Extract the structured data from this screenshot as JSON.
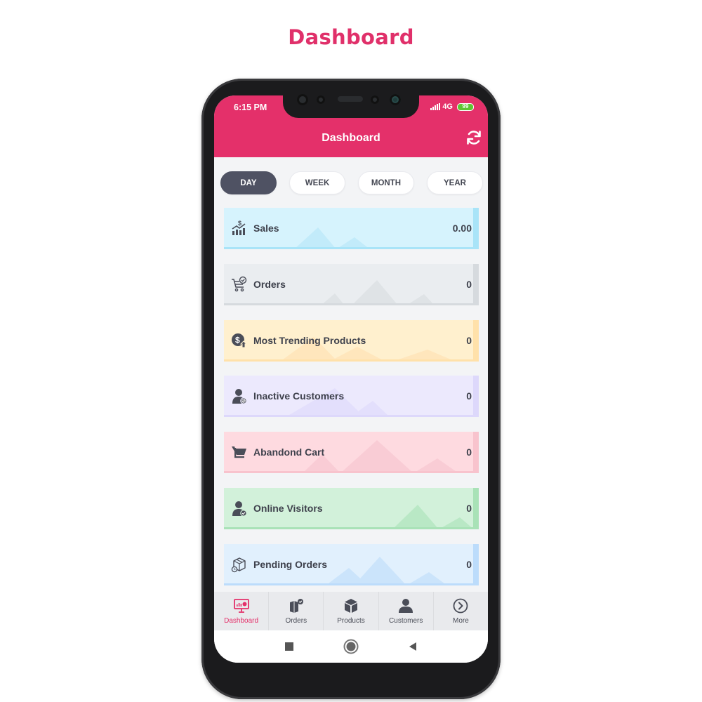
{
  "page": {
    "title": "Dashboard"
  },
  "status_bar": {
    "time": "6:15 PM",
    "network": "4G",
    "battery": "99"
  },
  "header": {
    "title": "Dashboard",
    "refresh_icon": "refresh-icon"
  },
  "period_tabs": [
    {
      "label": "DAY",
      "active": true
    },
    {
      "label": "WEEK",
      "active": false
    },
    {
      "label": "MONTH",
      "active": false
    },
    {
      "label": "YEAR",
      "active": false
    }
  ],
  "cards": [
    {
      "label": "Sales",
      "value": "0.00",
      "icon": "sales-chart-icon",
      "bg": "#d6f3fd",
      "accent": "#a9e4f8",
      "mountain": "#c2ebfa"
    },
    {
      "label": "Orders",
      "value": "0",
      "icon": "cart-check-icon",
      "bg": "#eaedf0",
      "accent": "#d6dade",
      "mountain": "#dfe3e6"
    },
    {
      "label": "Most Trending Products",
      "value": "0",
      "icon": "dollar-up-icon",
      "bg": "#fff0ce",
      "accent": "#ffe1aa",
      "mountain": "#ffe6bc"
    },
    {
      "label": "Inactive Customers",
      "value": "0",
      "icon": "user-blocked-icon",
      "bg": "#ece9fd",
      "accent": "#ddd8fb",
      "mountain": "#e3dffc"
    },
    {
      "label": "Abandond Cart",
      "value": "0",
      "icon": "cart-icon",
      "bg": "#fedae0",
      "accent": "#f8c3cd",
      "mountain": "#f9ccd5"
    },
    {
      "label": "Online Visitors",
      "value": "0",
      "icon": "user-online-icon",
      "bg": "#d2f1da",
      "accent": "#a9e2b7",
      "mountain": "#b9e8c5"
    },
    {
      "label": "Pending Orders",
      "value": "0",
      "icon": "package-pending-icon",
      "bg": "#e1f0fd",
      "accent": "#bcdcfb",
      "mountain": "#cbe4fb"
    }
  ],
  "bottom_nav": [
    {
      "label": "Dashboard",
      "icon": "dashboard-monitor-icon",
      "active": true
    },
    {
      "label": "Orders",
      "icon": "orders-box-icon",
      "active": false
    },
    {
      "label": "Products",
      "icon": "cube-icon",
      "active": false
    },
    {
      "label": "Customers",
      "icon": "user-icon",
      "active": false
    },
    {
      "label": "More",
      "icon": "chevron-right-circle-icon",
      "active": false
    }
  ],
  "colors": {
    "brand": "#e4306a",
    "tab_active": "#4f5263",
    "text": "#3e414c"
  }
}
